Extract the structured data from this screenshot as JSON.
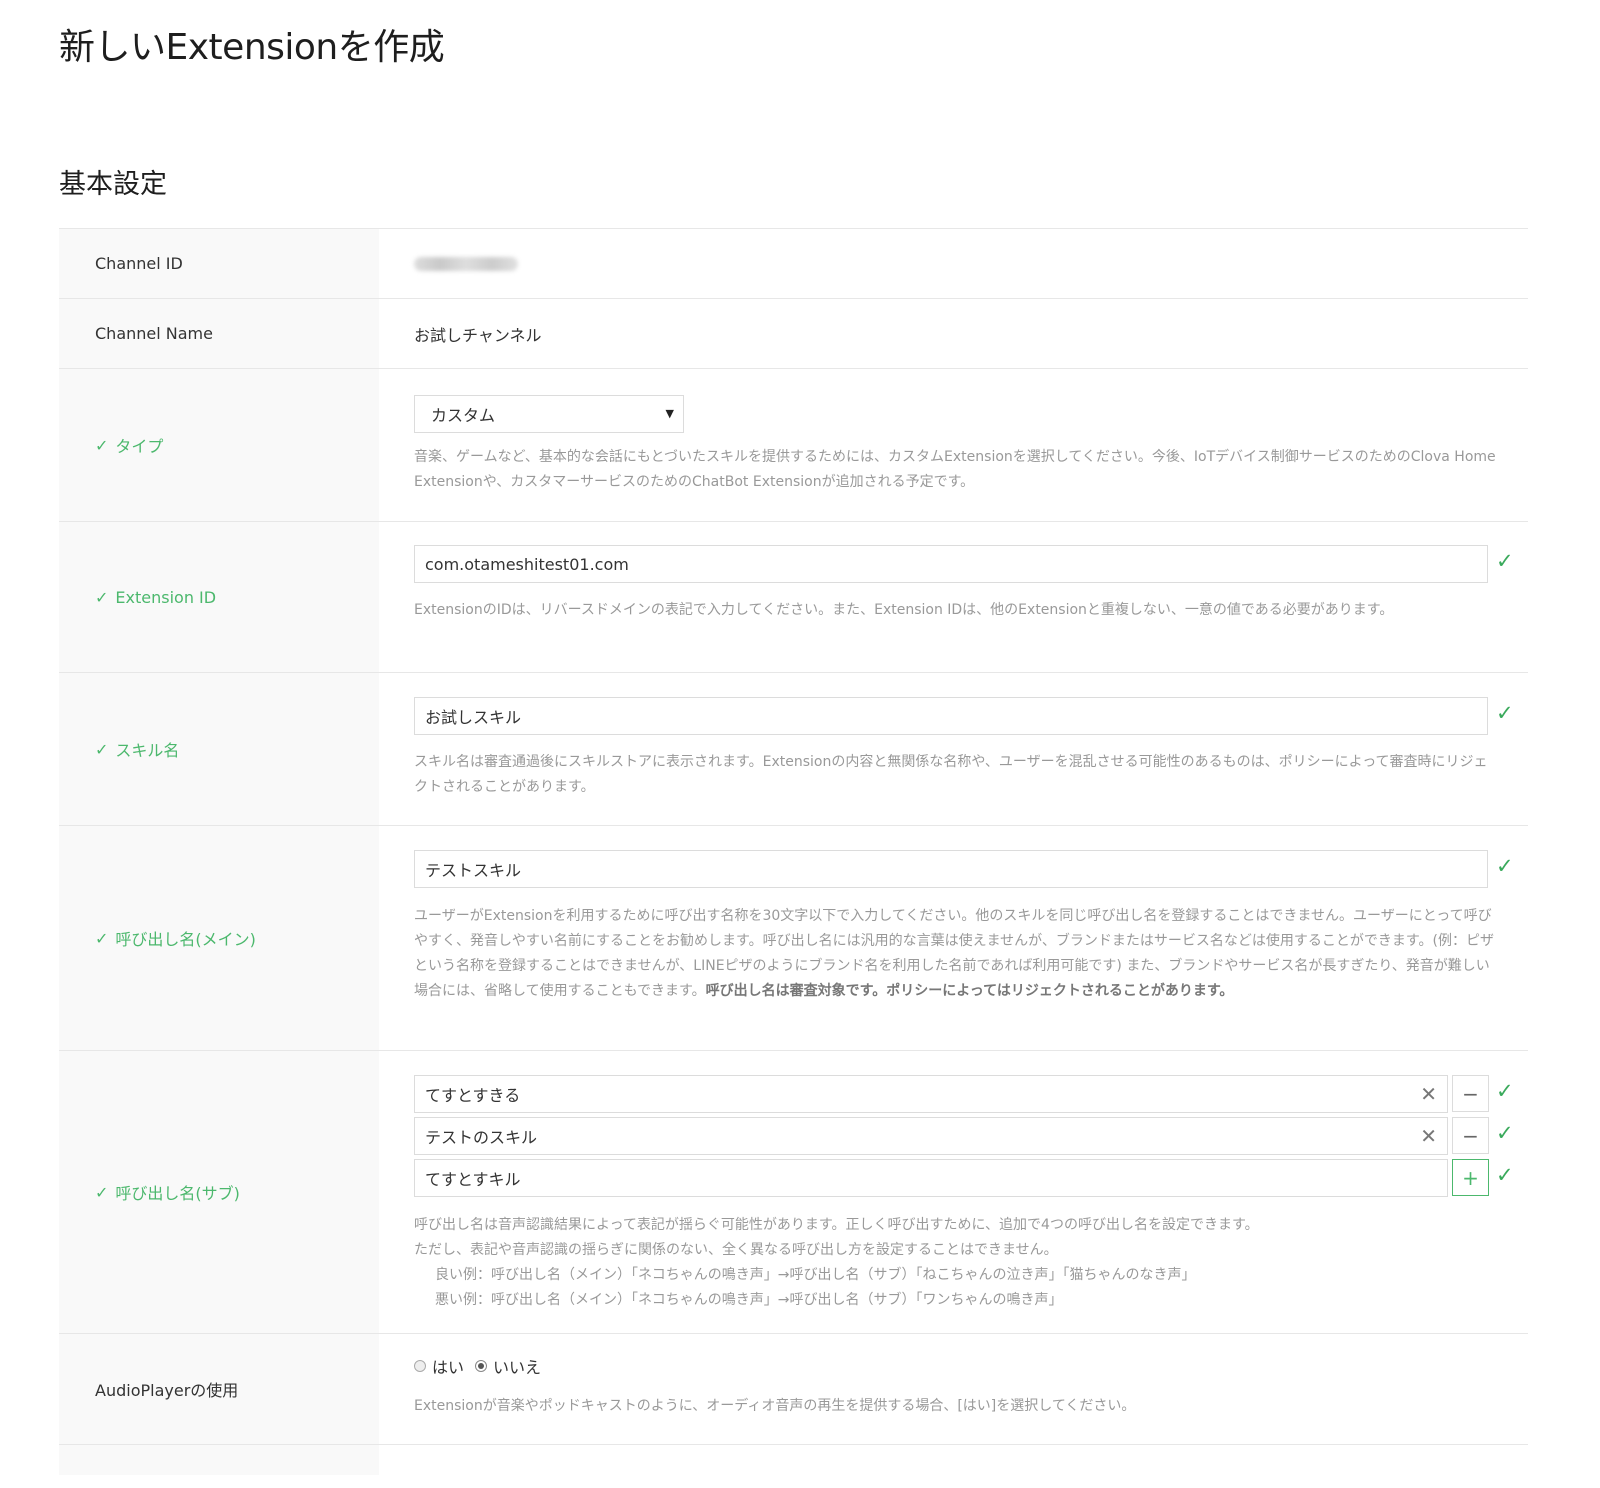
{
  "page_title": "新しいExtensionを作成",
  "section_title": "基本設定",
  "colors": {
    "valid_green": "#4cb86d",
    "check_green": "#3aaa5c",
    "label_bg": "#f9f9f9",
    "help_gray": "#999999"
  },
  "rows": {
    "channel_id": {
      "label": "Channel ID"
    },
    "channel_name": {
      "label": "Channel Name",
      "value": "お試しチャンネル"
    },
    "type": {
      "label": "タイプ",
      "selected": "カスタム",
      "help": "音楽、ゲームなど、基本的な会話にもとづいたスキルを提供するためには、カスタムExtensionを選択してください。今後、IoTデバイス制御サービスのためのClova Home Extensionや、カスタマーサービスのためのChatBot Extensionが追加される予定です。"
    },
    "extension_id": {
      "label": "Extension ID",
      "value": "com.otameshitest01.com",
      "help": "ExtensionのIDは、リバースドメインの表記で入力してください。また、Extension IDは、他のExtensionと重複しない、一意の値である必要があります。"
    },
    "skill_name": {
      "label": "スキル名",
      "value": "お試しスキル",
      "help": "スキル名は審査通過後にスキルストアに表示されます。Extensionの内容と無関係な名称や、ユーザーを混乱させる可能性のあるものは、ポリシーによって審査時にリジェクトされることがあります。"
    },
    "invocation_main": {
      "label": "呼び出し名(メイン)",
      "value": "テストスキル",
      "help": "ユーザーがExtensionを利用するために呼び出す名称を30文字以下で入力してください。他のスキルを同じ呼び出し名を登録することはできません。ユーザーにとって呼びやすく、発音しやすい名前にすることをお勧めします。呼び出し名には汎用的な言葉は使えませんが、ブランドまたはサービス名などは使用することができます。(例：ピザという名称を登録することはできませんが、LINEピザのようにブランド名を利用した名前であれば利用可能です) また、ブランドやサービス名が長すぎたり、発音が難しい場合には、省略して使用することもできます。",
      "help_bold": "呼び出し名は審査対象です。ポリシーによってはリジェクトされることがあります。"
    },
    "invocation_sub": {
      "label": "呼び出し名(サブ)",
      "values": [
        "てすとすきる",
        "テストのスキル",
        "てすとすキル"
      ],
      "remove_label": "−",
      "add_label": "+",
      "help_lines": [
        "呼び出し名は音声認識結果によって表記が揺らぐ可能性があります。正しく呼び出すために、追加で4つの呼び出し名を設定できます。",
        "ただし、表記や音声認識の揺らぎに関係のない、全く異なる呼び出し方を設定することはできません。",
        "良い例：呼び出し名（メイン）「ネコちゃんの鳴き声」→呼び出し名（サブ）「ねこちゃんの泣き声」「猫ちゃんのなき声」",
        "悪い例：呼び出し名（メイン）「ネコちゃんの鳴き声」→呼び出し名（サブ）「ワンちゃんの鳴き声」"
      ]
    },
    "audioplayer": {
      "label": "AudioPlayerの使用",
      "options": [
        "はい",
        "いいえ"
      ],
      "selected": "いいえ",
      "help": "Extensionが音楽やポッドキャストのように、オーディオ音声の再生を提供する場合、[はい]を選択してください。"
    }
  }
}
